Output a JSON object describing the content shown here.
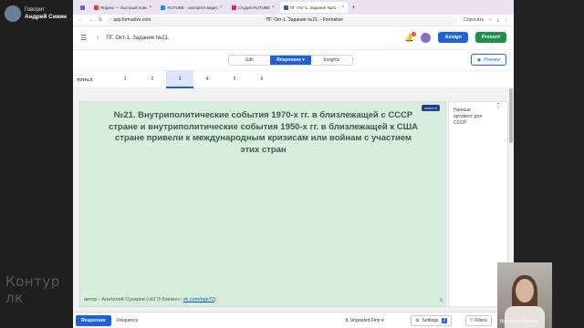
{
  "call": {
    "speaking_label": "Говорит",
    "speaker_name": "Андрей Сикин",
    "watermark": "Контур",
    "watermark2": "лк",
    "cam_name": "Виктория Юдкина"
  },
  "browser": {
    "tabs": [
      {
        "label": "",
        "color": "#7a5cc7"
      },
      {
        "label": "Яндекс — быстрый поис",
        "color": "#e53935"
      },
      {
        "label": "RUTUBE - смотрите видео",
        "color": "#1e88e5"
      },
      {
        "label": "Студия RUTUBE",
        "color": "#1e88e5"
      },
      {
        "label": "ПГ. Окт-1. Задание №21. -",
        "color": "#3f51b5"
      }
    ],
    "url": "app.formative.com",
    "page_title": "ПГ. Окт-1. Задание №21. - Formative",
    "ask_label": "Спросить"
  },
  "header": {
    "title": "ПГ. Окт-1. Задание №21.",
    "bell_count": "0",
    "assign_label": "Assign",
    "present_label": "Present"
  },
  "modes": {
    "edit": "Edit",
    "responses": "Responses",
    "insights": "Insights",
    "preview": "Preview"
  },
  "totals": {
    "label": "TOTALS",
    "columns": [
      "1",
      "2",
      "3",
      "4",
      "5",
      "6"
    ],
    "selected_index": 2
  },
  "question": {
    "zoom_label": "zoom in",
    "text": "№21. Внутриполитические события 1970-х гг. в близлежащей с СССР стране и внутриполитические события 1950-х гг. в близлежащей к США стране привели к международным кризисам или войнам с участием этих стран",
    "author_prefix": "автор - Анатолий Сухарев («ЕГЭ близко»: ",
    "author_link": "vk.com/ege72",
    "author_suffix": ")",
    "number": "5"
  },
  "side": {
    "text": "Напиши аргумент для СССР"
  },
  "bottom": {
    "responses": "Responses",
    "frequency": "Frequency",
    "ungraded": "Ungraded First",
    "settings": "Settings",
    "settings_count": "2",
    "filters": "Filters"
  }
}
